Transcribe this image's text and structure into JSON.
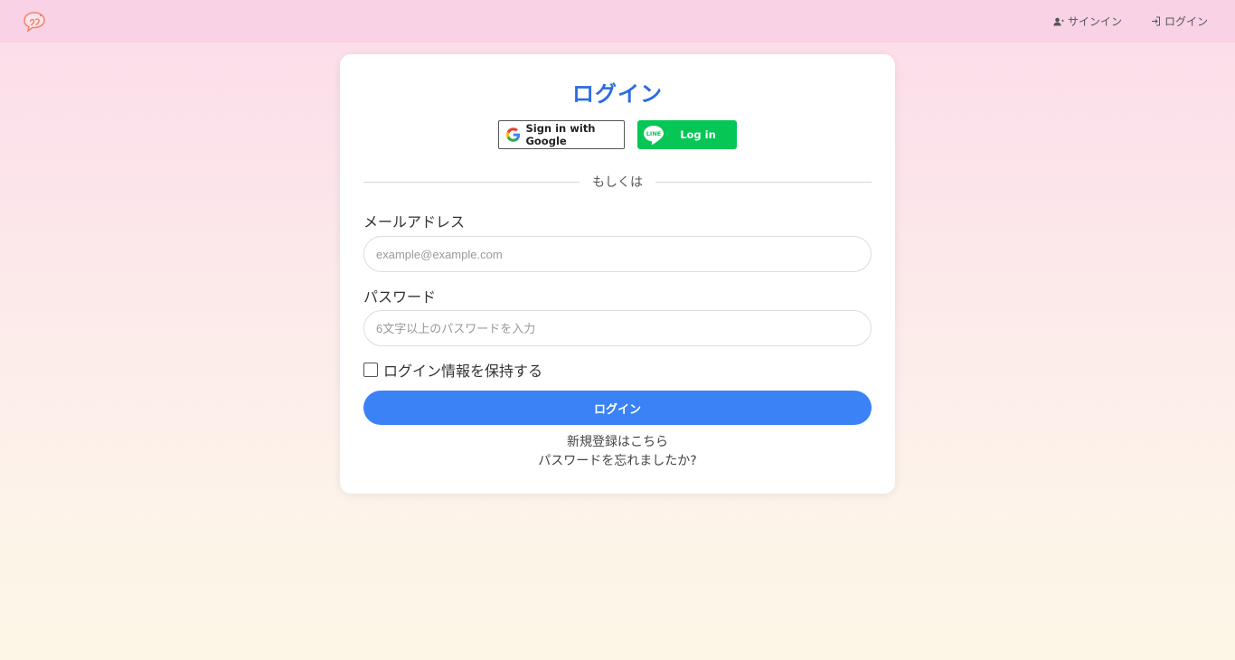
{
  "nav": {
    "signup_label": "サインイン",
    "login_label": "ログイン"
  },
  "card": {
    "title": "ログイン",
    "google_button": "Sign in with Google",
    "line_button": "Log in",
    "line_badge": "LINE",
    "divider_text": "もしくは",
    "email_label": "メールアドレス",
    "email_placeholder": "example@example.com",
    "email_value": "",
    "password_label": "パスワード",
    "password_placeholder": "6文字以上のパスワードを入力",
    "password_value": "",
    "remember_label": "ログイン情報を保持する",
    "remember_checked": false,
    "submit_label": "ログイン",
    "register_link": "新規登録はこちら",
    "forgot_link": "パスワードを忘れましたか?"
  },
  "colors": {
    "navbar": "#f9d2e6",
    "title": "#2a6de0",
    "primary_button": "#3b82f6",
    "line_green": "#06c755"
  },
  "icons": {
    "logo": "speech-bubble-logo",
    "signup": "user-plus-icon",
    "login": "login-arrow-icon",
    "google": "google-g-icon",
    "line": "line-logo-icon"
  }
}
